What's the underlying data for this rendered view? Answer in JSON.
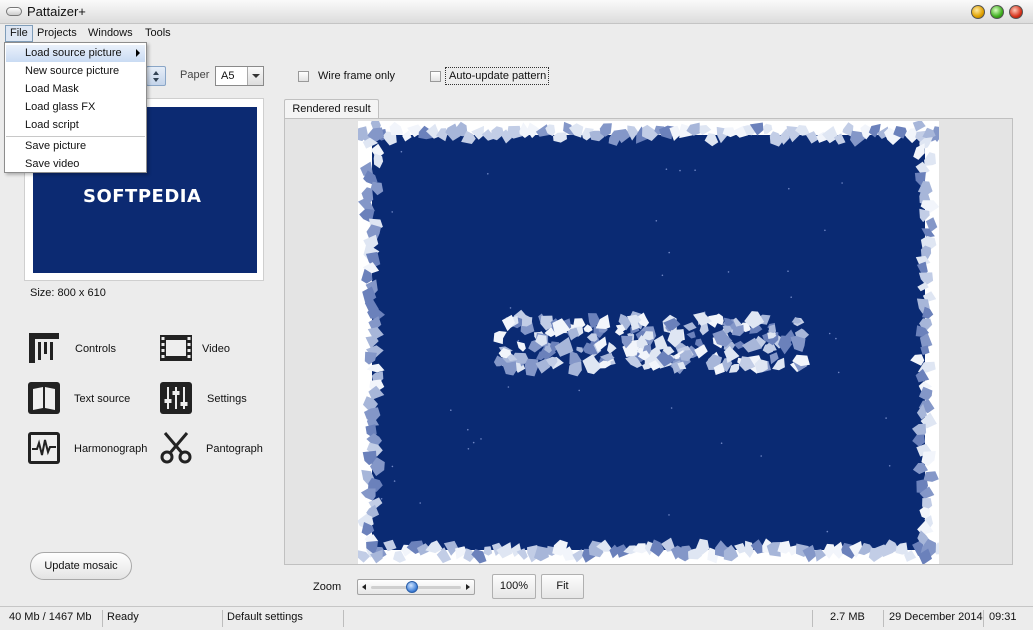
{
  "window": {
    "title": "Pattaizer+"
  },
  "menubar": {
    "items": [
      "File",
      "Projects",
      "Windows",
      "Tools"
    ]
  },
  "file_menu": {
    "items": [
      "Load source picture",
      "New source picture",
      "Load Mask",
      "Load glass FX",
      "Load script",
      "Save picture",
      "Save video"
    ],
    "highlighted": "Load source picture"
  },
  "toolbar": {
    "paper_label": "Paper",
    "paper_value": "A5",
    "wireframe_label": "Wire frame only",
    "autoupdate_label": "Auto-update pattern"
  },
  "preview": {
    "logo_text": "SOFTPEDIA",
    "size_text": "Size: 800 x 610"
  },
  "tools": [
    "Controls",
    "Video",
    "Text source",
    "Settings",
    "Harmonograph",
    "Pantograph"
  ],
  "update_button": "Update mosaic",
  "render": {
    "tab_label": "Rendered result",
    "canvas_bg": "#0a2a73"
  },
  "zoom": {
    "label": "Zoom",
    "btn_100": "100%",
    "btn_fit": "Fit",
    "level": 0.45
  },
  "status": {
    "memory": "40 Mb / 1467 Mb",
    "state": "Ready",
    "settings": "Default settings",
    "filesize": "2.7 MB",
    "date": "29 December 2014",
    "time": "09:31"
  }
}
